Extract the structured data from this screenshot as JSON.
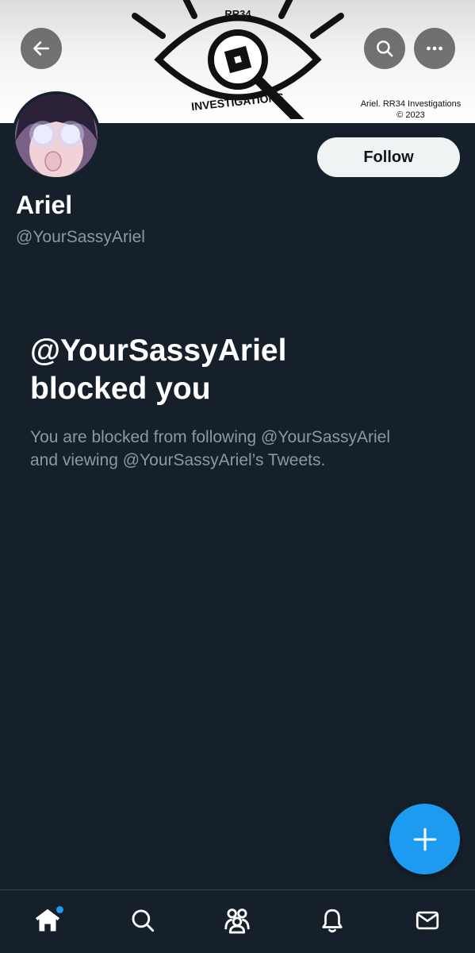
{
  "banner": {
    "logo_top_text": "RR34",
    "logo_bottom_text": "INVESTIGATIONS",
    "credit_line1": "Ariel. RR34 Investigations",
    "credit_line2": "© 2023"
  },
  "header": {
    "back_icon": "arrow-left-icon",
    "search_icon": "search-icon",
    "more_icon": "more-dots-icon"
  },
  "profile": {
    "display_name": "Ariel",
    "handle": "@YourSassyAriel",
    "follow_label": "Follow"
  },
  "blocked": {
    "title_line1": "@YourSassyAriel",
    "title_line2": "blocked you",
    "description_line1": "You are blocked from following @YourSassyAriel",
    "description_line2": "and viewing @YourSassyAriel’s Tweets."
  },
  "fab": {
    "icon": "plus-icon"
  },
  "bottom_nav": {
    "items": [
      "home-icon",
      "search-icon",
      "communities-icon",
      "notifications-icon",
      "messages-icon"
    ]
  },
  "colors": {
    "background": "#15202b",
    "accent": "#1d9bf0",
    "secondary_text": "#8b98a5"
  }
}
